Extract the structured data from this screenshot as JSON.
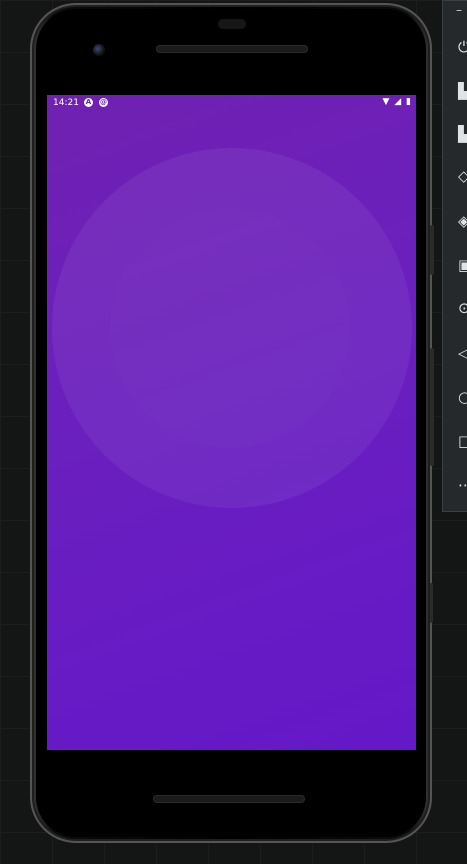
{
  "emulator_toolbar": {
    "minimize_label": "–",
    "items": [
      {
        "icon": "power-icon",
        "glyph": "⏻"
      },
      {
        "icon": "volume-up-icon",
        "glyph": "▙"
      },
      {
        "icon": "volume-down-icon",
        "glyph": "▙"
      },
      {
        "icon": "rotate-left-icon",
        "glyph": "◇"
      },
      {
        "icon": "rotate-right-icon",
        "glyph": "◈"
      },
      {
        "icon": "screenshot-icon",
        "glyph": "▣"
      },
      {
        "icon": "zoom-icon",
        "glyph": "⊙"
      },
      {
        "icon": "back-icon",
        "glyph": "◁"
      },
      {
        "icon": "home-icon",
        "glyph": "○"
      },
      {
        "icon": "overview-icon",
        "glyph": "□"
      },
      {
        "icon": "more-icon",
        "glyph": "⋯"
      }
    ]
  },
  "status_bar": {
    "time": "14:21",
    "badge_a": "A",
    "badge_b": "@",
    "wifi_glyph": "▼",
    "signal_glyph": "◢",
    "battery_glyph": "▮"
  },
  "colors": {
    "screen_top": "#7021b2",
    "screen_bottom": "#6418c8",
    "toolbar_bg": "#25292b"
  }
}
